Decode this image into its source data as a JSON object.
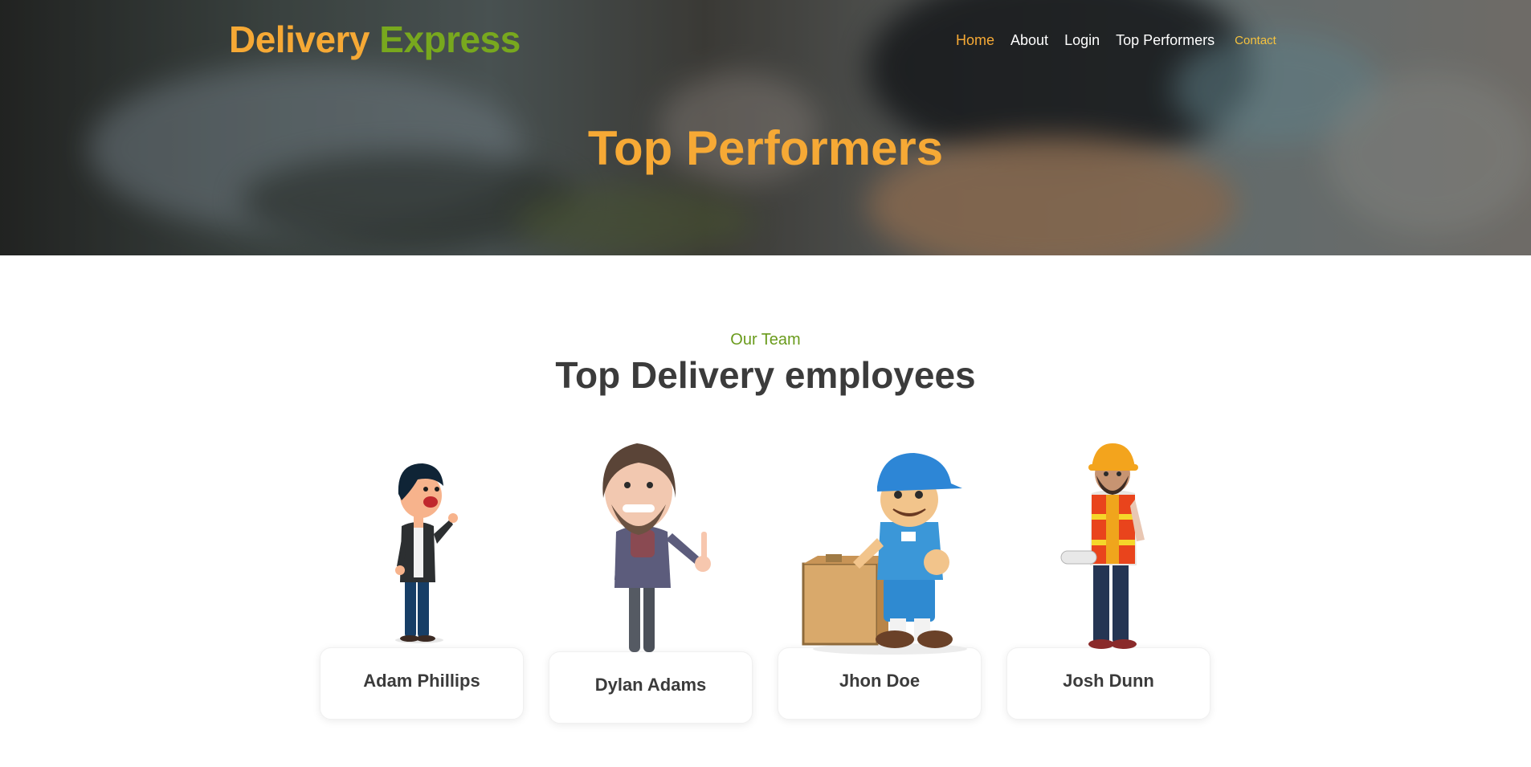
{
  "brand": {
    "part1": "Delivery",
    "part2": "Express"
  },
  "nav": {
    "items": [
      {
        "label": "Home",
        "active": true
      },
      {
        "label": "About"
      },
      {
        "label": "Login"
      },
      {
        "label": "Top Performers"
      },
      {
        "label": "Contact"
      }
    ]
  },
  "hero": {
    "title": "Top Performers"
  },
  "team": {
    "eyebrow": "Our Team",
    "title": "Top Delivery employees",
    "members": [
      {
        "name": "Adam Phillips"
      },
      {
        "name": "Dylan Adams"
      },
      {
        "name": "Jhon Doe"
      },
      {
        "name": "Josh Dunn"
      }
    ]
  },
  "colors": {
    "accent": "#f6a935",
    "brand_green": "#78a81e",
    "eyebrow_green": "#6a9b1c",
    "text_dark": "#3b3b3b"
  }
}
